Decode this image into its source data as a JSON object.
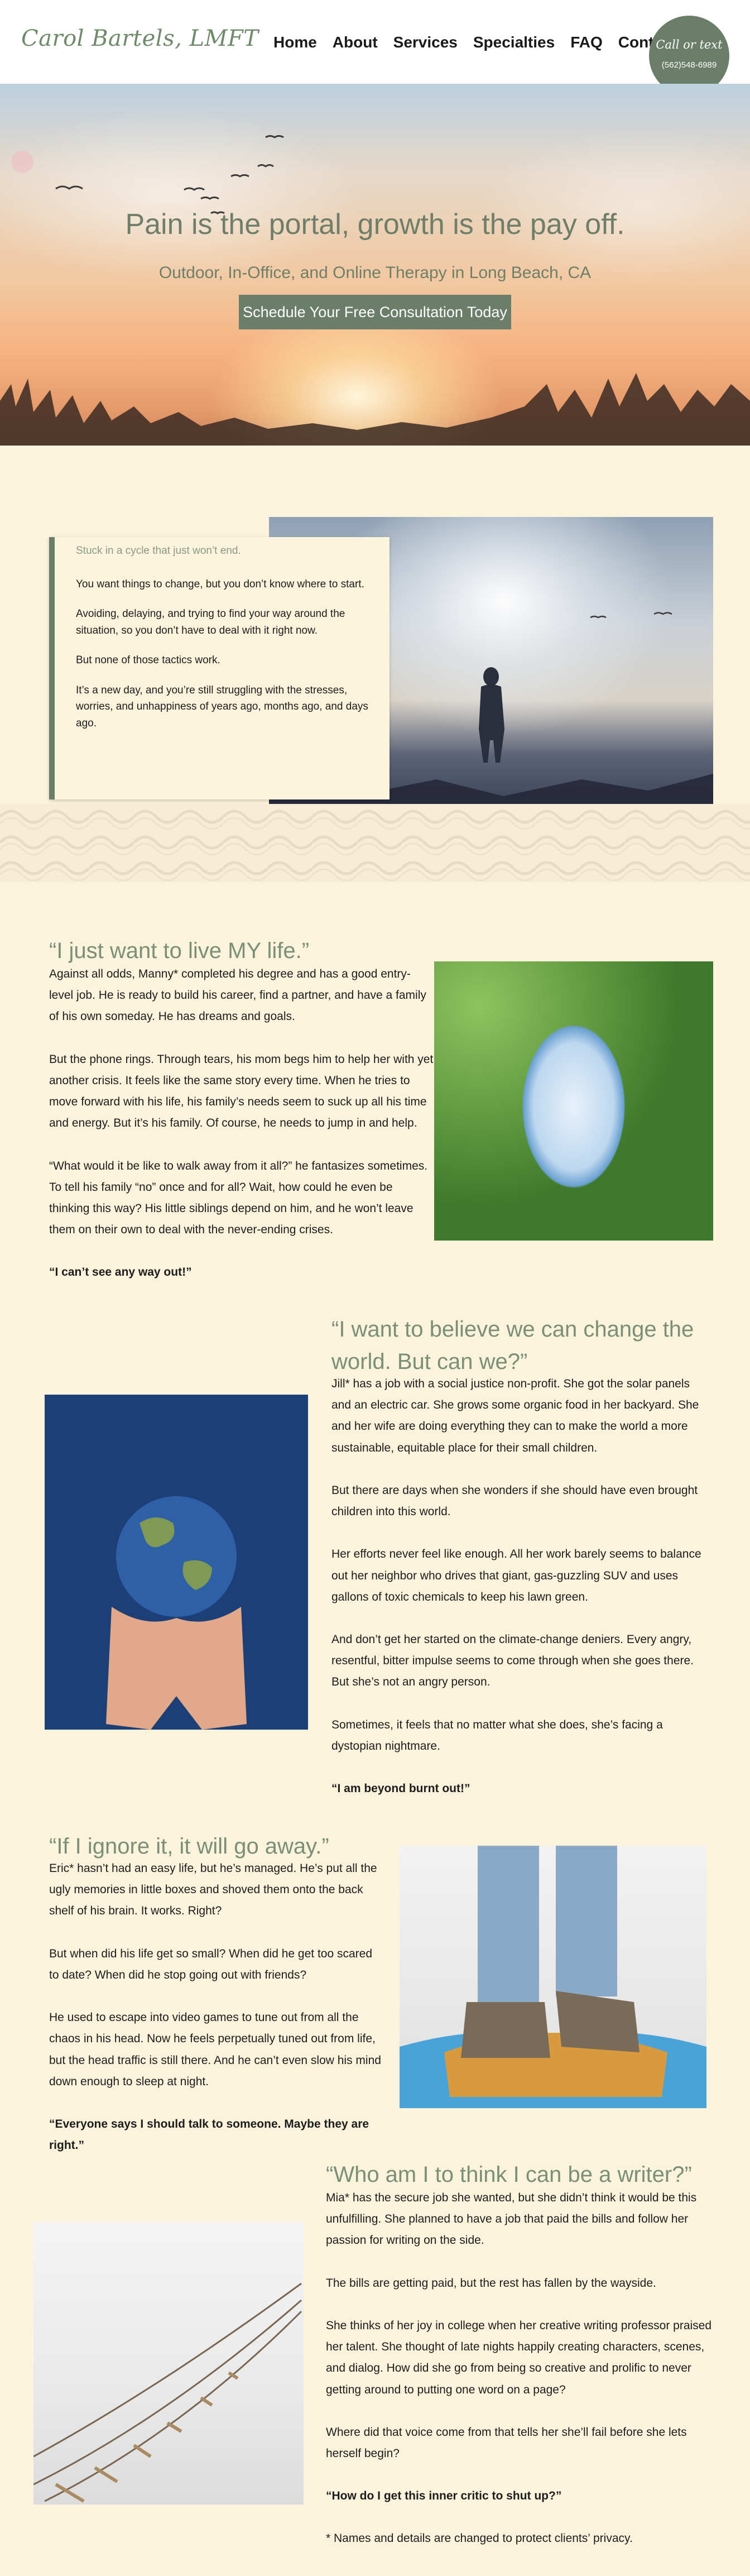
{
  "header": {
    "logo": "Carol Bartels, LMFT",
    "nav": [
      "Home",
      "About",
      "Services",
      "Specialties",
      "FAQ",
      "Contact"
    ],
    "call_badge": {
      "title": "Call or text",
      "phone": "(562)548-6989"
    }
  },
  "hero": {
    "title": "Pain is the portal, growth is the pay off.",
    "subtitle": "Outdoor, In-Office, and Online Therapy in Long Beach, CA",
    "cta": "Schedule Your Free Consultation Today"
  },
  "intro": {
    "lead": "Stuck in a cycle that just won’t end.",
    "paragraphs": [
      "You want things to change, but you don’t know where to start.",
      "Avoiding, delaying, and trying to find your way around the situation, so you don’t have to deal with it right now.",
      "But none of those tactics work.",
      "It’s a new day, and you’re still struggling with the stresses, worries, and unhappiness of years ago, months ago, and days ago."
    ]
  },
  "stories": [
    {
      "title": "“I just want to live MY life.”",
      "paragraphs": [
        "Against all odds, Manny* completed his degree and has a good entry-level job. He is ready to build his career, find a partner, and have a family of his own someday. He has dreams and goals.",
        "But the phone rings. Through tears, his mom begs him to help her with yet another crisis. It feels like the same story every time. When he tries to move forward with his life, his family’s needs seem to suck up all his time and energy. But it’s his family. Of course, he needs to jump in and help.",
        "“What would it be like to walk away from it all?” he fantasizes sometimes. To tell his family “no” once and for all? Wait, how could he even be thinking this way? His little siblings depend on him, and he won’t leave them on their own to deal with the never-ending crises."
      ],
      "closing": "“I can’t see any way out!”"
    },
    {
      "title": "“I want to believe we can change the world. But can we?”",
      "paragraphs": [
        "Jill* has a job with a social justice non-profit. She got the solar panels and an electric car. She grows some organic food in her backyard. She and her wife are doing everything they can to make the world a more sustainable, equitable place for their small children.",
        "But there are days when she wonders if she should have even brought children into this world.",
        "Her efforts never feel like enough. All her work barely seems to balance out her neighbor who drives that giant, gas-guzzling SUV and uses gallons of toxic chemicals to keep his lawn green.",
        "And don’t get her started on the climate-change deniers. Every angry, resentful, bitter impulse seems to come through when she goes there. But she’s not an angry person.",
        "Sometimes, it feels that no matter what she does, she’s facing a dystopian nightmare."
      ],
      "closing": "“I am beyond burnt out!”"
    },
    {
      "title": "“If I ignore it, it will go away.”",
      "paragraphs": [
        "Eric* hasn’t had an easy life, but he’s managed. He’s put all the ugly memories in little boxes and shoved them onto the back shelf of his brain. It works. Right?",
        "But when did his life get so small? When did he get too scared to date? When did he stop going out with friends?",
        "He used to escape into video games to tune out from all the chaos in his head. Now he feels perpetually tuned out from life, but the head traffic is still there. And he can’t even slow his mind down enough to sleep at night."
      ],
      "closing": "“Everyone says I should talk to someone. Maybe they are right.”"
    },
    {
      "title": "“Who am I to think I can be a writer?”",
      "paragraphs": [
        "Mia* has the secure job she wanted, but she didn’t think it would be this unfulfilling. She planned to have a job that paid the bills and follow her passion for writing on the side.",
        "The bills are getting paid, but the rest has fallen by the wayside.",
        "She thinks of her joy in college when her creative writing professor praised her talent. She thought of late nights happily creating characters, scenes, and dialog. How did she go from being so creative and prolific to never getting around to putting one word on a page?",
        "Where did that voice come from that tells her she’ll fail before she lets herself begin?"
      ],
      "closing": "“How do I get this inner critic to shut up?”",
      "footnote": "* Names and details are changed to protect clients’ privacy."
    }
  ],
  "colors": {
    "accent": "#6b7e6a",
    "title_green": "#7a8f74",
    "page_bg": "#fcf3dc"
  }
}
